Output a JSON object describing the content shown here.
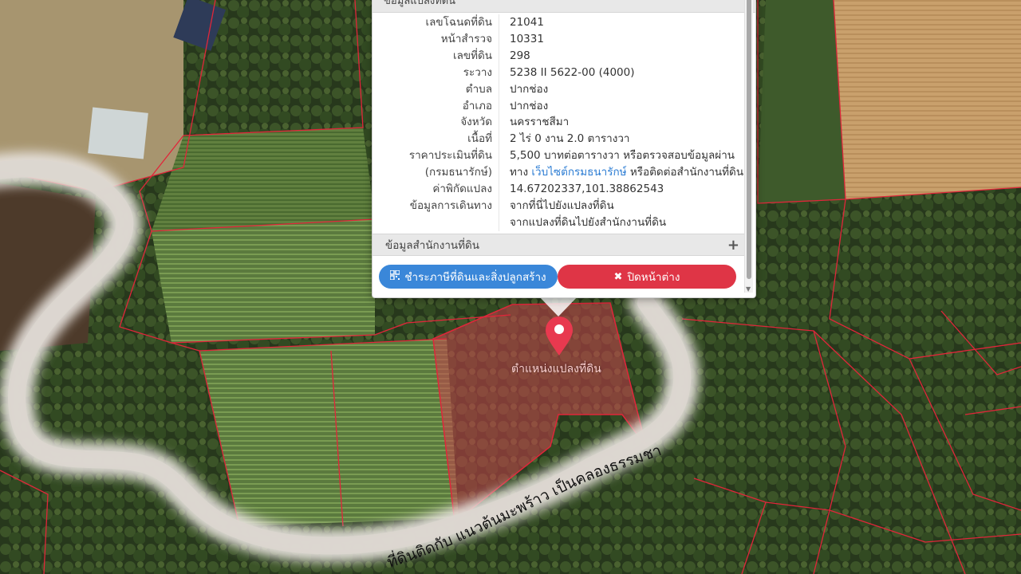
{
  "popup": {
    "top_header": "ข้อมูลแปลงที่ดิน",
    "fields": [
      {
        "label": "เลขโฉนดที่ดิน",
        "value": "21041"
      },
      {
        "label": "หน้าสำรวจ",
        "value": "10331"
      },
      {
        "label": "เลขที่ดิน",
        "value": "298"
      },
      {
        "label": "ระวาง",
        "value": "5238 II 5622-00 (4000)"
      },
      {
        "label": "ตำบล",
        "value": "ปากช่อง"
      },
      {
        "label": "อำเภอ",
        "value": "ปากช่อง"
      },
      {
        "label": "จังหวัด",
        "value": "นครราชสีมา"
      },
      {
        "label": "เนื้อที่",
        "value": "2 ไร่ 0 งาน 2.0 ตารางวา"
      }
    ],
    "appraisal": {
      "label1": "ราคาประเมินที่ดิน",
      "label2": "(กรมธนารักษ์)",
      "line1": "5,500 บาทต่อตารางวา หรือตรวจสอบข้อมูลผ่าน",
      "line2_pre": "ทาง",
      "line2_link": "เว็บไซต์กรมธนารักษ์",
      "line2_post": "หรือติดต่อสำนักงานที่ดิน"
    },
    "coord": {
      "label": "ค่าพิกัดแปลง",
      "value": "14.67202337,101.38862543"
    },
    "travel": {
      "label": "ข้อมูลการเดินทาง",
      "link1": "จากที่นี่ไปยังแปลงที่ดิน",
      "link2": "จากแปลงที่ดินไปยังสำนักงานที่ดิน"
    },
    "office_section": "ข้อมูลสำนักงานที่ดิน",
    "plus_icon": "+",
    "tax_button": "ชำระภาษีที่ดินและสิ่งปลูกสร้าง",
    "close_button": "ปิดหน้าต่าง"
  },
  "map": {
    "pin_label": "ตำแหน่งแปลงที่ดิน",
    "annotation": "ที่ดินติดกับ แนวต้นมะพร้าว เป็นคลองธรรมชาติ",
    "colors": {
      "parcel_line": "#e0263a",
      "selected_fill": "#c9424d",
      "pin": "#e8394f",
      "path": "#e6e1dc"
    }
  }
}
